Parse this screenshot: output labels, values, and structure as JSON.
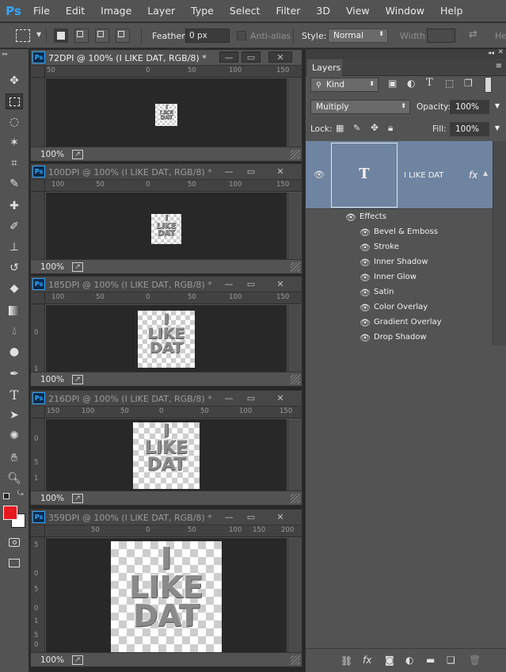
{
  "app": {
    "logo": "Ps"
  },
  "menu": [
    "File",
    "Edit",
    "Image",
    "Layer",
    "Type",
    "Select",
    "Filter",
    "3D",
    "View",
    "Window",
    "Help"
  ],
  "options": {
    "feather_label": "Feather:",
    "feather_value": "0 px",
    "antialias_label": "Anti-alias",
    "style_label": "Style:",
    "style_value": "Normal",
    "width_label": "Width:",
    "height_label": "He"
  },
  "documents": [
    {
      "title": "72DPI @ 100% (I LIKE DAT, RGB/8) *",
      "zoom": "100%",
      "ruler": [
        "50",
        "0",
        "50",
        "100",
        "150"
      ]
    },
    {
      "title": "100DPI @ 100% (I LIKE DAT, RGB/8) *",
      "zoom": "100%",
      "ruler": [
        "100",
        "50",
        "0",
        "50",
        "100",
        "150"
      ]
    },
    {
      "title": "185DPI @ 100% (I LIKE DAT, RGB/8) *",
      "zoom": "100%",
      "ruler": [
        "100",
        "50",
        "0",
        "50",
        "100",
        "150"
      ],
      "vruler": [
        "0",
        "1"
      ]
    },
    {
      "title": "216DPI @ 100% (I LIKE DAT, RGB/8) *",
      "zoom": "100%",
      "ruler": [
        "150",
        "100",
        "50",
        "0",
        "50",
        "100",
        "150"
      ],
      "vruler": [
        "0",
        "5",
        "1"
      ]
    },
    {
      "title": "359DPI @ 100% (I LIKE DAT, RGB/8) *",
      "zoom": "100%",
      "ruler": [
        "50",
        "0",
        "50",
        "100",
        "150",
        "200"
      ],
      "vruler": [
        "5",
        "0",
        "5",
        "0",
        "1",
        "5",
        "0"
      ]
    }
  ],
  "artwork_text": [
    "I",
    "LIKE",
    "DAT"
  ],
  "layers_panel": {
    "tab": "Layers",
    "kind": "Kind",
    "blend_mode": "Multiply",
    "opacity_label": "Opacity:",
    "opacity_value": "100%",
    "lock_label": "Lock:",
    "fill_label": "Fill:",
    "fill_value": "100%",
    "layer": {
      "name": "I LIKE DAT",
      "thumb_glyph": "T",
      "fx": "fx"
    },
    "effects_label": "Effects",
    "effects": [
      "Bevel & Emboss",
      "Stroke",
      "Inner Shadow",
      "Inner Glow",
      "Satin",
      "Color Overlay",
      "Gradient Overlay",
      "Drop Shadow"
    ],
    "selected_color": "#6f84a0"
  },
  "colors": {
    "foreground": "#e8181f",
    "background": "#ffffff",
    "ps_blue": "#31a8ff"
  }
}
